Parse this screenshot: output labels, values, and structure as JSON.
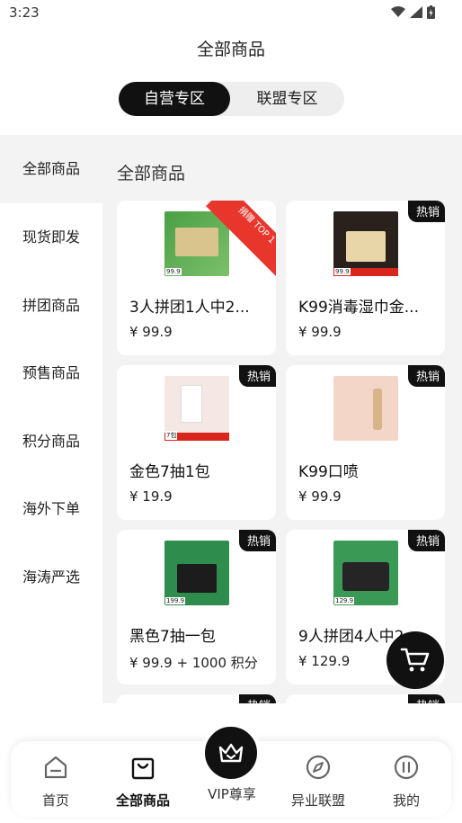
{
  "status_bar": {
    "time": "3:23"
  },
  "page_title": "全部商品",
  "segments": [
    {
      "label": "自营专区",
      "active": true
    },
    {
      "label": "联盟专区",
      "active": false
    }
  ],
  "sidebar": {
    "items": [
      {
        "label": "全部商品",
        "active": true
      },
      {
        "label": "现货即发"
      },
      {
        "label": "拼团商品"
      },
      {
        "label": "预售商品"
      },
      {
        "label": "积分商品"
      },
      {
        "label": "海外下单"
      },
      {
        "label": "海涛严选"
      }
    ]
  },
  "main": {
    "section_title": "全部商品",
    "products": [
      {
        "name": "3人拼团1人中2...",
        "price": "¥ 99.9",
        "ribbon": "捐赠 TOP 1",
        "img_label": "99.9"
      },
      {
        "name": "K99消毒湿巾金...",
        "price": "¥ 99.9",
        "badge": "热销",
        "img_label": "99.9"
      },
      {
        "name": "金色7抽1包",
        "price": "¥ 19.9",
        "badge": "热销",
        "img_label": "7包"
      },
      {
        "name": "K99口喷",
        "price": "¥ 99.9",
        "badge": "热销"
      },
      {
        "name": "黑色7抽一包",
        "price": "¥ 99.9 + 1000 积分",
        "badge": "热销",
        "img_label": "199.9"
      },
      {
        "name": "9人拼团4人中2...",
        "price": "¥ 129.9",
        "badge": "热销",
        "img_label": "129.9"
      },
      {
        "name": "",
        "price": "",
        "badge": "热销"
      },
      {
        "name": "",
        "price": "",
        "badge": "热销"
      }
    ]
  },
  "tabbar": {
    "tabs": [
      {
        "label": "首页",
        "icon": "home-icon"
      },
      {
        "label": "全部商品",
        "icon": "shopping-bag-icon",
        "active": true
      },
      {
        "label": "VIP尊享",
        "icon": "crown-icon"
      },
      {
        "label": "异业联盟",
        "icon": "compass-icon"
      },
      {
        "label": "我的",
        "icon": "pause-circle-icon"
      }
    ]
  },
  "colors": {
    "accent": "#111111",
    "ribbon": "#e8362d",
    "background": "#f3f3f3"
  }
}
